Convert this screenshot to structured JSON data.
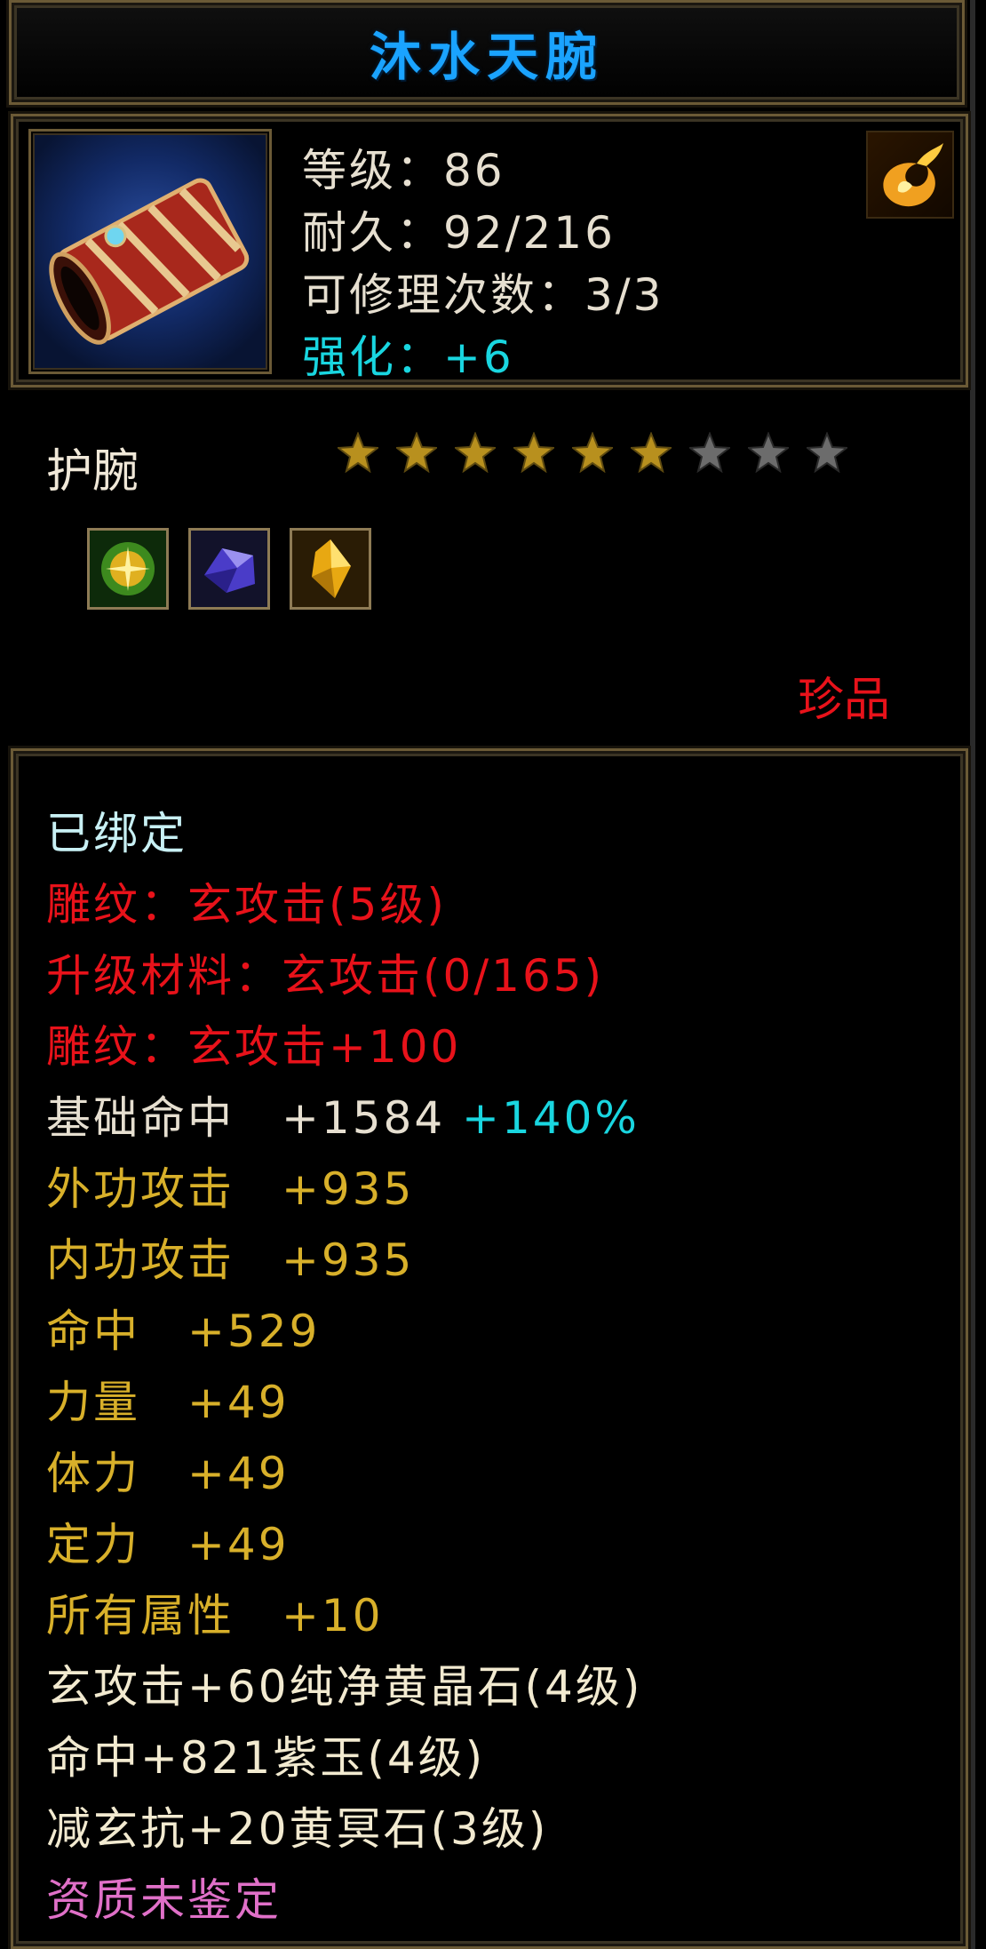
{
  "title": "沐水天腕",
  "item": {
    "icon": "bracer-icon",
    "level_label": "等级：86",
    "durability_label": "耐久：92/216",
    "repair_label": "可修理次数：3/3",
    "enhance_label": "强化：+6",
    "corner_icon": "flame-swirl-icon"
  },
  "type": "护腕",
  "stars": {
    "filled": 6,
    "total": 9
  },
  "gems": [
    "green-yellow-gem-icon",
    "purple-jade-gem-icon",
    "yellow-crystal-gem-icon"
  ],
  "rarity": "珍品",
  "colors": {
    "title": "#1aa3ff",
    "red": "#e8121a",
    "yellow": "#d8b02a",
    "cyan": "#19d6e0",
    "pink": "#e070c8"
  },
  "lines": {
    "bound": "已绑定",
    "engrave": "雕纹：玄攻击(5级)",
    "upgrade_mat": "升级材料：玄攻击(0/165)",
    "engrave_bonus": "雕纹：玄攻击+100",
    "base_hit": "基础命中　+1584",
    "base_hit_pct": "+140%",
    "ext_atk": "外功攻击　+935",
    "int_atk": "内功攻击　+935",
    "hit": "命中　+529",
    "strength": "力量　+49",
    "stamina": "体力　+49",
    "focus": "定力　+49",
    "all_attr": "所有属性　+10",
    "gem1": "玄攻击+60纯净黄晶石(4级)",
    "gem2": "命中+821紫玉(4级)",
    "gem3": "减玄抗+20黄冥石(3级)",
    "quality": "资质未鉴定"
  }
}
